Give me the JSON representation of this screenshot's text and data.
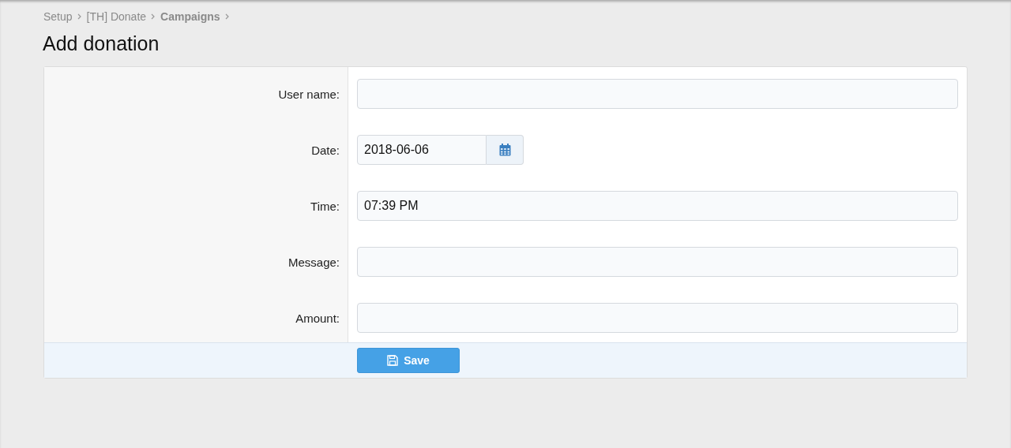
{
  "breadcrumb": [
    {
      "label": "Setup",
      "selected": false
    },
    {
      "label": "[TH] Donate",
      "selected": false
    },
    {
      "label": "Campaigns",
      "selected": true
    }
  ],
  "title": "Add donation",
  "fields": [
    {
      "label": "User name:",
      "kind": "text"
    },
    {
      "label": "Date:",
      "kind": "date",
      "value": "2018-06-06"
    },
    {
      "label": "Time:",
      "kind": "text",
      "value": "07:39 PM"
    },
    {
      "label": "Message:",
      "kind": "text"
    },
    {
      "label": "Amount:",
      "kind": "text"
    }
  ],
  "save_button": "Save"
}
